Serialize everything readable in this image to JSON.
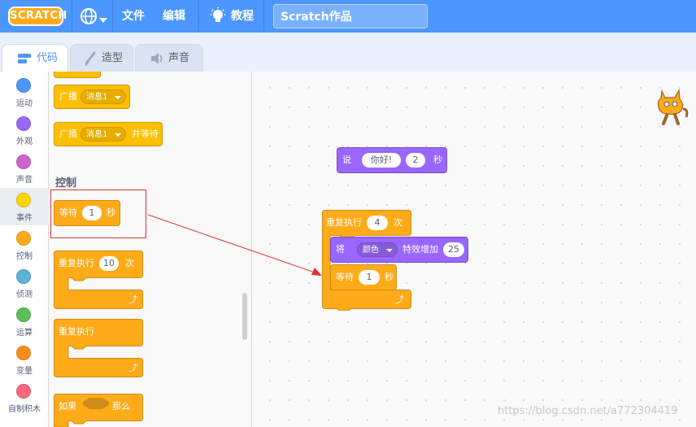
{
  "menubar": {
    "logo": "SCRATCH",
    "file": "文件",
    "edit": "编辑",
    "tutorials": "教程",
    "project_title": "Scratch作品",
    "colors": {
      "bar": "#4c97ff"
    }
  },
  "tabs": [
    {
      "label": "代码",
      "icon": "code-icon",
      "active": true
    },
    {
      "label": "造型",
      "icon": "brush-icon",
      "active": false
    },
    {
      "label": "声音",
      "icon": "speaker-icon",
      "active": false
    }
  ],
  "categories": [
    {
      "label": "运动",
      "color": "#4c97ff"
    },
    {
      "label": "外观",
      "color": "#9966ff"
    },
    {
      "label": "声音",
      "color": "#cf63cf"
    },
    {
      "label": "事件",
      "color": "#ffd500",
      "selected": true
    },
    {
      "label": "控制",
      "color": "#ffab19"
    },
    {
      "label": "侦测",
      "color": "#5cb1d6"
    },
    {
      "label": "运算",
      "color": "#59c059"
    },
    {
      "label": "变量",
      "color": "#ff8c1a"
    },
    {
      "label": "自制积木",
      "color": "#ff6680"
    }
  ],
  "palette": {
    "broadcast1": {
      "label": "广播",
      "message": "消息1"
    },
    "broadcast_wait": {
      "label": "广播",
      "message": "消息1",
      "suffix": "并等待"
    },
    "section_control": "控制",
    "wait": {
      "label": "等待",
      "value": "1",
      "unit": "秒"
    },
    "repeat": {
      "label": "重复执行",
      "value": "10",
      "unit": "次"
    },
    "forever": {
      "label": "重复执行"
    },
    "if_then": {
      "label": "如果",
      "then": "那么"
    }
  },
  "workspace": {
    "say": {
      "label": "说",
      "text": "你好!",
      "value": "2",
      "unit": "秒"
    },
    "repeat": {
      "label": "重复执行",
      "value": "4",
      "unit": "次"
    },
    "effect": {
      "label": "将",
      "effect": "颜色",
      "mid": "特效增加",
      "value": "25"
    },
    "wait": {
      "label": "等待",
      "value": "1",
      "unit": "秒"
    }
  },
  "watermark": "https://blog.csdn.net/a772304419",
  "annotation_color": "#e03030"
}
